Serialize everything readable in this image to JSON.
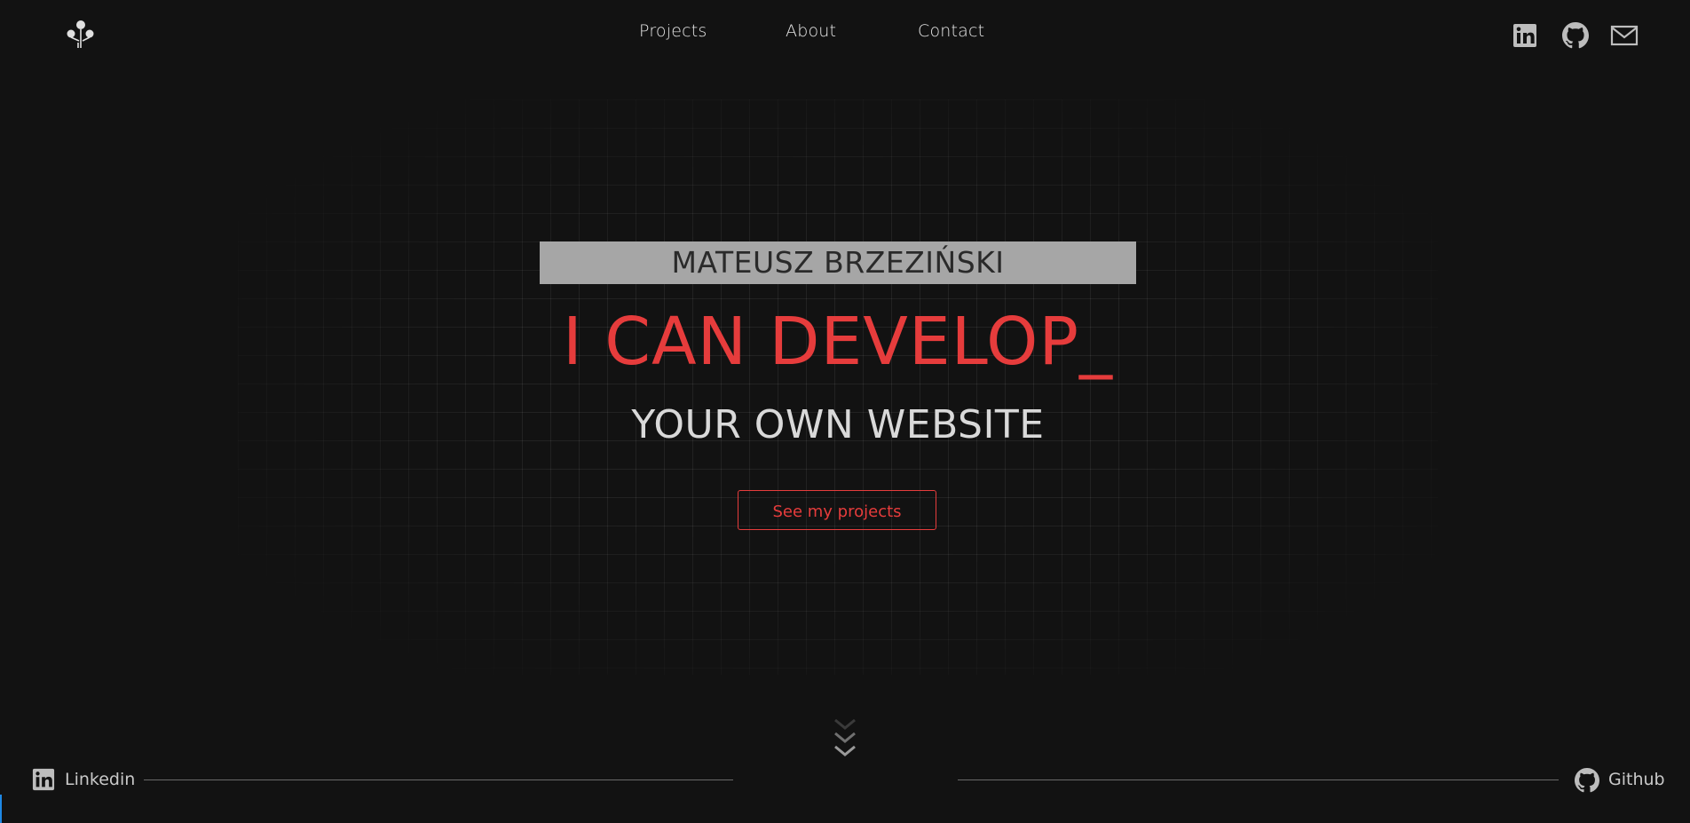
{
  "header": {
    "logo_icon": "tree-network-icon",
    "nav": [
      {
        "label": "Projects"
      },
      {
        "label": "About"
      },
      {
        "label": "Contact"
      }
    ],
    "social": [
      {
        "icon": "linkedin-icon"
      },
      {
        "icon": "github-icon"
      },
      {
        "icon": "mail-icon"
      }
    ]
  },
  "hero": {
    "name": "MATEUSZ BRZEZIŃSKI",
    "headline": "I CAN DEVELOP_",
    "subline": "YOUR OWN WEBSITE",
    "cta_label": "See my projects",
    "scroll_icon": "chevrons-down-icon"
  },
  "footer": {
    "linkedin_label": "Linkedin",
    "github_label": "Github"
  },
  "colors": {
    "background": "#121212",
    "accent": "#e63c3c",
    "name_box": "#a6a6a6",
    "text_light": "#d9d9d9"
  }
}
